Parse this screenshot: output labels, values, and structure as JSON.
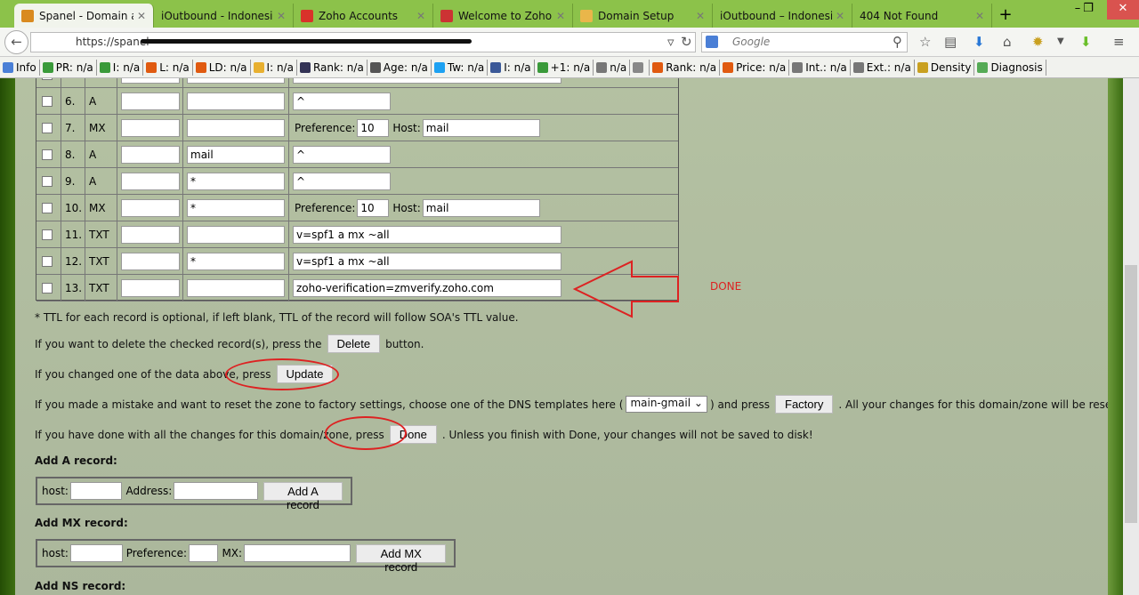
{
  "browser": {
    "tabs": [
      {
        "title": "Spanel - Domain a...",
        "icon": "spanel-icon",
        "color": "#d98a1f",
        "active": true
      },
      {
        "title": "iOutbound - Indonesia...",
        "icon": "none",
        "color": ""
      },
      {
        "title": "Zoho Accounts",
        "icon": "zoho-icon",
        "color": "#d9322a"
      },
      {
        "title": "Welcome to Zoho!...",
        "icon": "gmail-icon",
        "color": "#c33"
      },
      {
        "title": "Domain Setup",
        "icon": "mail-icon",
        "color": "#e9b64a"
      },
      {
        "title": "iOutbound – Indonesia...",
        "icon": "none",
        "color": ""
      },
      {
        "title": "404 Not Found",
        "icon": "none",
        "color": ""
      }
    ],
    "url": "https://spanel-",
    "search_placeholder": "Google",
    "bookmarks": [
      "Info",
      "PR: n/a",
      "I: n/a",
      "L: n/a",
      "LD: n/a",
      "I: n/a",
      "Rank: n/a",
      "Age: n/a",
      "Tw: n/a",
      "I: n/a",
      "+1: n/a",
      "n/a",
      "",
      "Rank: n/a",
      "Price: n/a",
      "Int.: n/a",
      "Ext.: n/a",
      "Density",
      "Diagnosis"
    ]
  },
  "records": [
    {
      "num": "",
      "type": "",
      "host": "",
      "kind": "plain",
      "value": ""
    },
    {
      "num": "6.",
      "type": "A",
      "host": "",
      "kind": "short",
      "value": "^"
    },
    {
      "num": "7.",
      "type": "MX",
      "host": "",
      "kind": "mx",
      "pref": "10",
      "mxhost": "mail"
    },
    {
      "num": "8.",
      "type": "A",
      "host": "mail",
      "kind": "short",
      "value": "^"
    },
    {
      "num": "9.",
      "type": "A",
      "host": "*",
      "kind": "short",
      "value": "^"
    },
    {
      "num": "10.",
      "type": "MX",
      "host": "*",
      "kind": "mx",
      "pref": "10",
      "mxhost": "mail"
    },
    {
      "num": "11.",
      "type": "TXT",
      "host": "",
      "kind": "long",
      "value": "v=spf1 a mx ~all"
    },
    {
      "num": "12.",
      "type": "TXT",
      "host": "*",
      "kind": "long",
      "value": "v=spf1 a mx ~all"
    },
    {
      "num": "13.",
      "type": "TXT",
      "host": "",
      "kind": "long",
      "value": "zoho-verification=zmverify.zoho.com"
    }
  ],
  "labels": {
    "preference": "Preference:",
    "host": "Host:"
  },
  "annotation": {
    "done_text": "DONE",
    "color": "#d22222"
  },
  "text": {
    "ttl_note": "* TTL for each record is optional, if left blank, TTL of the record will follow SOA's TTL value.",
    "delete_pre": "If you want to delete the checked record(s), press the",
    "delete_btn": "Delete",
    "delete_post": "button.",
    "update_pre": "If you changed one of the data above, press",
    "update_btn": "Update",
    "reset_pre": "If you made a mistake and want to reset the zone to factory settings, choose one of the DNS templates here (",
    "template": "main-gmail",
    "reset_mid": ") and press",
    "factory_btn": "Factory",
    "reset_post": ". All your changes for this domain/zone will be reset!",
    "done_pre": "If you have done with all the changes for this domain/zone, press",
    "done_btn": "Done",
    "done_post": ". Unless you finish with Done, your changes will not be saved to disk!",
    "add_a": "Add A record:",
    "a_host": "host:",
    "a_address": "Address:",
    "add_a_btn": "Add A record",
    "add_mx": "Add MX record:",
    "mx_host": "host:",
    "mx_pref": "Preference:",
    "mx_mx": "MX:",
    "add_mx_btn": "Add MX record",
    "add_ns": "Add NS record:"
  }
}
